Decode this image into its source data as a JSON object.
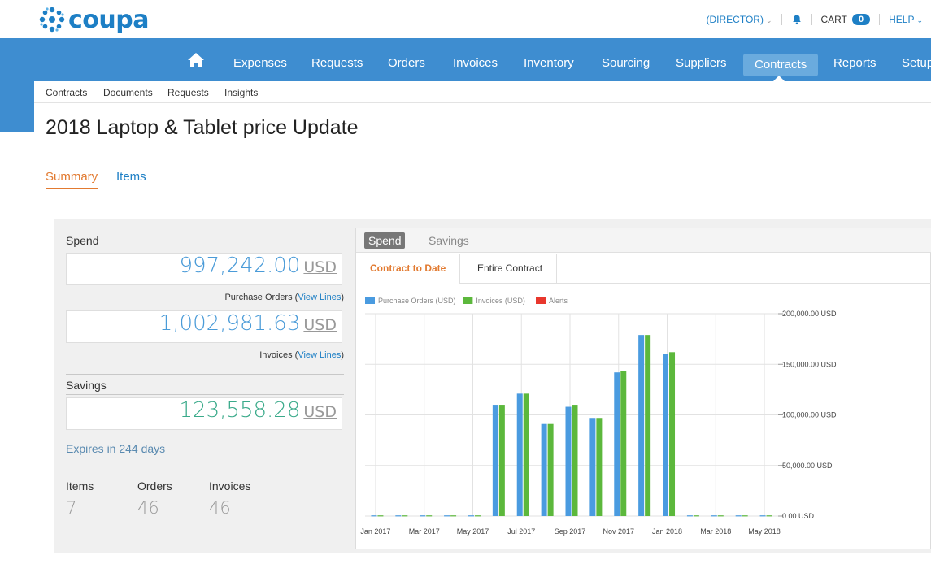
{
  "header": {
    "logo_text": "coupa",
    "role": "(DIRECTOR)",
    "cart_label": "CART",
    "cart_count": "0",
    "help_label": "HELP"
  },
  "nav": {
    "items": [
      "Expenses",
      "Requests",
      "Orders",
      "Invoices",
      "Inventory",
      "Sourcing",
      "Suppliers",
      "Contracts",
      "Reports",
      "Setup"
    ],
    "active": "Contracts"
  },
  "subnav": [
    "Contracts",
    "Documents",
    "Requests",
    "Insights"
  ],
  "page": {
    "title": "2018 Laptop & Tablet price Update",
    "tabs": [
      "Summary",
      "Items"
    ],
    "active_tab": "Summary"
  },
  "summary": {
    "spend_label": "Spend",
    "po_value": "997,242.00",
    "po_currency": "USD",
    "po_caption": "Purchase Orders (",
    "po_link": "View Lines",
    "po_close": ")",
    "inv_value": "1,002,981.63",
    "inv_currency": "USD",
    "inv_caption": "Invoices (",
    "inv_link": "View Lines",
    "inv_close": ")",
    "savings_label": "Savings",
    "savings_value": "123,558.28",
    "savings_currency": "USD",
    "expires": "Expires in 244 days",
    "stats": [
      {
        "label": "Items",
        "value": "7"
      },
      {
        "label": "Orders",
        "value": "46"
      },
      {
        "label": "Invoices",
        "value": "46"
      }
    ]
  },
  "chart_panel": {
    "tabs": [
      "Spend",
      "Savings"
    ],
    "active_tab": "Spend",
    "subtabs": [
      "Contract to Date",
      "Entire Contract"
    ],
    "active_subtab": "Contract to Date"
  },
  "chart_data": {
    "type": "bar",
    "categories": [
      "Jan 2017",
      "Feb 2017",
      "Mar 2017",
      "Apr 2017",
      "May 2017",
      "Jun 2017",
      "Jul 2017",
      "Aug 2017",
      "Sep 2017",
      "Oct 2017",
      "Nov 2017",
      "Dec 2017",
      "Jan 2018",
      "Feb 2018",
      "Mar 2018",
      "Apr 2018",
      "May 2018"
    ],
    "tick_labels": [
      "Jan 2017",
      "Mar 2017",
      "May 2017",
      "Jul 2017",
      "Sep 2017",
      "Nov 2017",
      "Jan 2018",
      "Mar 2018",
      "May 2018"
    ],
    "series": [
      {
        "name": "Purchase Orders (USD)",
        "color": "#4a9be0",
        "values": [
          0,
          0,
          0,
          0,
          0,
          110000,
          121000,
          91000,
          108000,
          97000,
          142000,
          179000,
          160000,
          0,
          0,
          0,
          0
        ]
      },
      {
        "name": "Invoices (USD)",
        "color": "#5cb83c",
        "values": [
          0,
          0,
          0,
          0,
          0,
          110000,
          121000,
          91000,
          110000,
          97000,
          143000,
          179000,
          162000,
          0,
          0,
          0,
          0
        ]
      },
      {
        "name": "Alerts",
        "color": "#e8372d",
        "values": []
      }
    ],
    "y_ticks": [
      "0.00 USD",
      "50,000.00 USD",
      "100,000.00 USD",
      "150,000.00 USD",
      "200,000.00 USD"
    ],
    "ylim": [
      0,
      200000
    ],
    "grid": true,
    "legend_position": "top-left"
  }
}
